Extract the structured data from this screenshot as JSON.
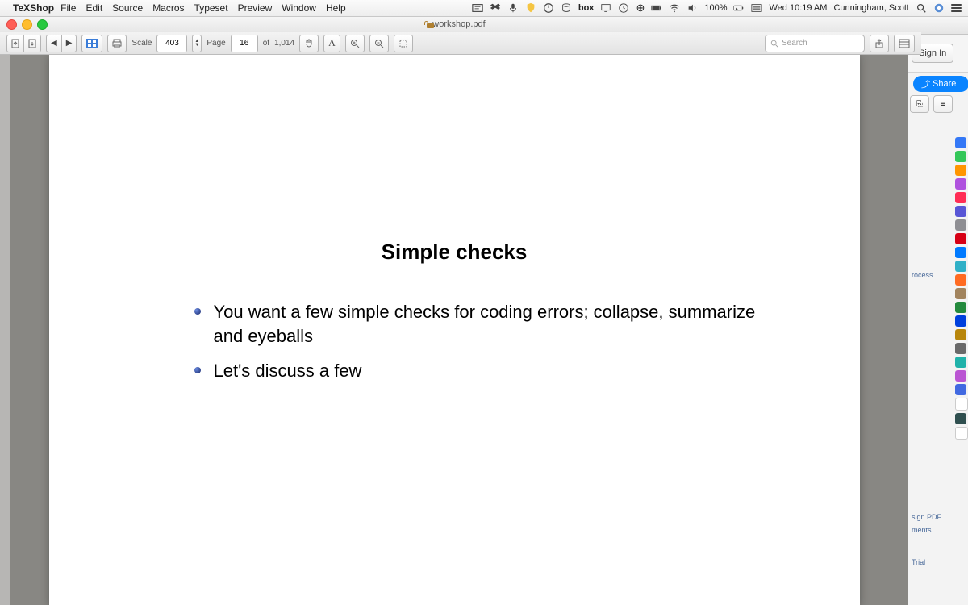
{
  "menubar": {
    "app_name": "TeXShop",
    "menus": [
      "File",
      "Edit",
      "Source",
      "Macros",
      "Typeset",
      "Preview",
      "Window",
      "Help"
    ],
    "battery": "100%",
    "battery_icon": "⚡",
    "time": "Wed 10:19 AM",
    "user": "Cunningham, Scott"
  },
  "window": {
    "title": "workshop.pdf"
  },
  "toolbar": {
    "scale_label": "Scale",
    "scale_value": "403",
    "page_label": "Page",
    "page_value": "16",
    "of_label": "of",
    "total_pages": "1,014",
    "search_placeholder": "Search"
  },
  "slide": {
    "title": "Simple checks",
    "bullets": [
      "You want a few simple checks for coding errors; collapse, summarize and eyeballs",
      "Let's discuss a few"
    ]
  },
  "bg_window": {
    "signin": "Sign In",
    "share": "Share",
    "links": {
      "process": "rocess",
      "sign": "sign PDF",
      "comments": "ments",
      "trial": "Trial"
    }
  }
}
